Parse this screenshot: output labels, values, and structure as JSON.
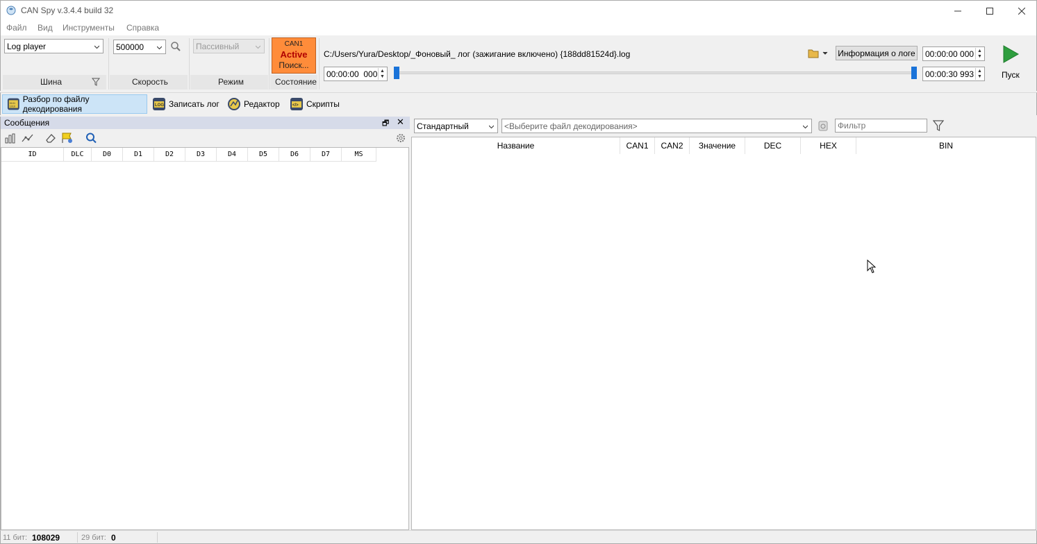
{
  "window": {
    "title": "CAN Spy v.3.4.4 build 32"
  },
  "menu": [
    "Файл",
    "Вид",
    "Инструменты",
    "Справка"
  ],
  "toolbar": {
    "bus": {
      "value": "Log player",
      "label": "Шина"
    },
    "speed": {
      "value": "500000",
      "label": "Скорость"
    },
    "mode": {
      "value": "Пассивный",
      "label": "Режим"
    },
    "state": {
      "channel": "CAN1",
      "status": "Active",
      "sub": "Поиск...",
      "label": "Состояние"
    },
    "file_path": "C:/Users/Yura/Desktop/_Фоновый_ лог (зажигание включено) {188dd81524d}.log",
    "time_start": "00:00:00  000",
    "time_range_start": "00:00:00 000",
    "time_range_end": "00:00:30 993",
    "log_info_button": "Информация о логе",
    "play_label": "Пуск"
  },
  "tabs": [
    {
      "label": "Разбор по файлу декодирования",
      "icon": "decode-file-icon",
      "active": true
    },
    {
      "label": "Записать лог",
      "icon": "log-icon",
      "active": false
    },
    {
      "label": "Редактор",
      "icon": "editor-icon",
      "active": false
    },
    {
      "label": "Скрипты",
      "icon": "scripts-icon",
      "active": false
    }
  ],
  "messages_panel": {
    "title": "Сообщения",
    "columns": [
      "ID",
      "DLC",
      "D0",
      "D1",
      "D2",
      "D3",
      "D4",
      "D5",
      "D6",
      "D7",
      "MS"
    ]
  },
  "decode_panel": {
    "type_value": "Стандартный",
    "decode_file_placeholder": "<Выберите файл декодирования>",
    "filter_placeholder": "Фильтр",
    "columns": [
      "Название",
      "CAN1",
      "CAN2",
      "Значение",
      "DEC",
      "HEX",
      "BIN"
    ]
  },
  "status": {
    "bits11_label": "11 бит:",
    "bits11_value": "108029",
    "bits29_label": "29 бит:",
    "bits29_value": "0"
  },
  "colors": {
    "state_bg": "#ff8c3a",
    "state_text": "#b00000",
    "slider": "#1a73d9",
    "tab_active_bg": "#cce4f7",
    "play": "#2e9e3e"
  }
}
